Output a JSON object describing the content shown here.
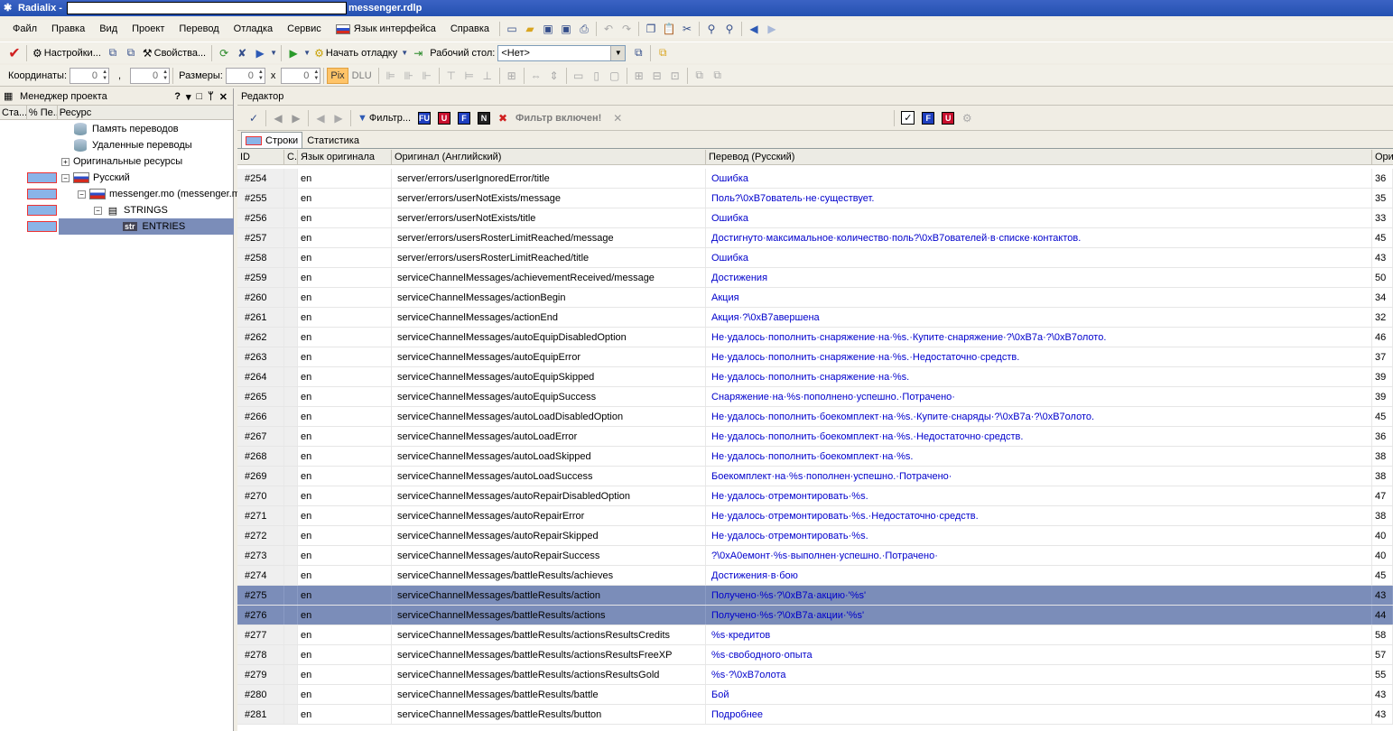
{
  "window": {
    "app_name": "Radialix",
    "title_separator": " - ",
    "file_name": "messenger.rdlp"
  },
  "menu": [
    "Файл",
    "Правка",
    "Вид",
    "Проект",
    "Перевод",
    "Отладка",
    "Сервис",
    "Язык интерфейса",
    "Справка"
  ],
  "toolbar1": {
    "settings_label": "Настройки...",
    "properties_label": "Свойства...",
    "start_debug_label": "Начать отладку",
    "workspace_label": "Рабочий стол:",
    "workspace_value": "<Нет>"
  },
  "toolbar2": {
    "coords_label": "Координаты:",
    "coord_x": "0",
    "comma": ",",
    "coord_y": "0",
    "sizes_label": "Размеры:",
    "size_w": "0",
    "x_sep": "x",
    "size_h": "0",
    "pix_label": "Pix",
    "dlu_label": "DLU"
  },
  "project_manager": {
    "title": "Менеджер проекта",
    "controls": [
      "?",
      "▾",
      "□",
      "ᛘ",
      "✕"
    ],
    "columns": [
      "Ста...",
      "% Пе...",
      "Ресурс"
    ],
    "tree": [
      {
        "label": "Память переводов"
      },
      {
        "label": "Удаленные переводы"
      },
      {
        "label": "Оригинальные ресурсы",
        "expander": "+"
      },
      {
        "label": "Русский",
        "expander": "−"
      },
      {
        "label": "messenger.mo (messenger.mo)",
        "expander": "−"
      },
      {
        "label": "STRINGS",
        "expander": "−"
      },
      {
        "label": "ENTRIES",
        "icon_text": "str"
      }
    ]
  },
  "editor": {
    "title": "Редактор",
    "filter_label": "Фильтр...",
    "filter_badges": [
      {
        "text": "FU",
        "color": "#1f3fbf"
      },
      {
        "text": "U",
        "color": "#c8102e"
      },
      {
        "text": "F",
        "color": "#1f3fbf"
      },
      {
        "text": "N",
        "color": "#222222"
      }
    ],
    "filter_status": "Фильтр включен!",
    "right_badges": [
      {
        "text": "F",
        "color": "#1f3fbf"
      },
      {
        "text": "U",
        "color": "#c8102e"
      }
    ],
    "tabs": [
      "Строки",
      "Статистика"
    ],
    "columns": [
      "ID",
      "С.",
      "Язык оригинала",
      "Оригинал (Английский)",
      "Перевод (Русский)",
      "Ори"
    ],
    "rows": [
      {
        "id": "#254",
        "lang": "en",
        "original": "server/errors/userIgnoredError/title",
        "translation": "Ошибка",
        "len": "36"
      },
      {
        "id": "#255",
        "lang": "en",
        "original": "server/errors/userNotExists/message",
        "translation": "Поль?\\0xB7ователь·не·существует.",
        "len": "35"
      },
      {
        "id": "#256",
        "lang": "en",
        "original": "server/errors/userNotExists/title",
        "translation": "Ошибка",
        "len": "33"
      },
      {
        "id": "#257",
        "lang": "en",
        "original": "server/errors/usersRosterLimitReached/message",
        "translation": "Достигнуто·максимальное·количество·поль?\\0xB7ователей·в·списке·контактов.",
        "len": "45"
      },
      {
        "id": "#258",
        "lang": "en",
        "original": "server/errors/usersRosterLimitReached/title",
        "translation": "Ошибка",
        "len": "43"
      },
      {
        "id": "#259",
        "lang": "en",
        "original": "serviceChannelMessages/achievementReceived/message",
        "translation": "Достижения",
        "len": "50"
      },
      {
        "id": "#260",
        "lang": "en",
        "original": "serviceChannelMessages/actionBegin",
        "translation": "Акция",
        "len": "34"
      },
      {
        "id": "#261",
        "lang": "en",
        "original": "serviceChannelMessages/actionEnd",
        "translation": "Акция·?\\0xB7авершена",
        "len": "32"
      },
      {
        "id": "#262",
        "lang": "en",
        "original": "serviceChannelMessages/autoEquipDisabledOption",
        "translation": "Не·удалось·пополнить·снаряжение·на·%s.·Купите·снаряжение·?\\0xB7а·?\\0xB7олото.",
        "len": "46"
      },
      {
        "id": "#263",
        "lang": "en",
        "original": "serviceChannelMessages/autoEquipError",
        "translation": "Не·удалось·пополнить·снаряжение·на·%s.·Недостаточно·средств.",
        "len": "37"
      },
      {
        "id": "#264",
        "lang": "en",
        "original": "serviceChannelMessages/autoEquipSkipped",
        "translation": "Не·удалось·пополнить·снаряжение·на·%s.",
        "len": "39"
      },
      {
        "id": "#265",
        "lang": "en",
        "original": "serviceChannelMessages/autoEquipSuccess",
        "translation": "Снаряжение·на·%s·пополнено·успешно.·Потрачено·",
        "len": "39"
      },
      {
        "id": "#266",
        "lang": "en",
        "original": "serviceChannelMessages/autoLoadDisabledOption",
        "translation": "Не·удалось·пополнить·боекомплект·на·%s.·Купите·снаряды·?\\0xB7а·?\\0xB7олото.",
        "len": "45"
      },
      {
        "id": "#267",
        "lang": "en",
        "original": "serviceChannelMessages/autoLoadError",
        "translation": "Не·удалось·пополнить·боекомплект·на·%s.·Недостаточно·средств.",
        "len": "36"
      },
      {
        "id": "#268",
        "lang": "en",
        "original": "serviceChannelMessages/autoLoadSkipped",
        "translation": "Не·удалось·пополнить·боекомплект·на·%s.",
        "len": "38"
      },
      {
        "id": "#269",
        "lang": "en",
        "original": "serviceChannelMessages/autoLoadSuccess",
        "translation": "Боекомплект·на·%s·пополнен·успешно.·Потрачено·",
        "len": "38"
      },
      {
        "id": "#270",
        "lang": "en",
        "original": "serviceChannelMessages/autoRepairDisabledOption",
        "translation": "Не·удалось·отремонтировать·%s.",
        "len": "47"
      },
      {
        "id": "#271",
        "lang": "en",
        "original": "serviceChannelMessages/autoRepairError",
        "translation": "Не·удалось·отремонтировать·%s.·Недостаточно·средств.",
        "len": "38"
      },
      {
        "id": "#272",
        "lang": "en",
        "original": "serviceChannelMessages/autoRepairSkipped",
        "translation": "Не·удалось·отремонтировать·%s.",
        "len": "40"
      },
      {
        "id": "#273",
        "lang": "en",
        "original": "serviceChannelMessages/autoRepairSuccess",
        "translation": "?\\0xA0емонт·%s·выполнен·успешно.·Потрачено·",
        "len": "40"
      },
      {
        "id": "#274",
        "lang": "en",
        "original": "serviceChannelMessages/battleResults/achieves",
        "translation": "Достижения·в·бою",
        "len": "45"
      },
      {
        "id": "#275",
        "lang": "en",
        "original": "serviceChannelMessages/battleResults/action",
        "translation": "Получено·%s·?\\0xB7а·акцию·'%s'",
        "len": "43",
        "selected": true
      },
      {
        "id": "#276",
        "lang": "en",
        "original": "serviceChannelMessages/battleResults/actions",
        "translation": "Получено·%s·?\\0xB7а·акции·'%s'",
        "len": "44",
        "selected": true
      },
      {
        "id": "#277",
        "lang": "en",
        "original": "serviceChannelMessages/battleResults/actionsResultsCredits",
        "translation": "%s·кредитов",
        "len": "58"
      },
      {
        "id": "#278",
        "lang": "en",
        "original": "serviceChannelMessages/battleResults/actionsResultsFreeXP",
        "translation": "%s·свободного·опыта",
        "len": "57"
      },
      {
        "id": "#279",
        "lang": "en",
        "original": "serviceChannelMessages/battleResults/actionsResultsGold",
        "translation": "%s·?\\0xB7олота",
        "len": "55"
      },
      {
        "id": "#280",
        "lang": "en",
        "original": "serviceChannelMessages/battleResults/battle",
        "translation": "Бой",
        "len": "43"
      },
      {
        "id": "#281",
        "lang": "en",
        "original": "serviceChannelMessages/battleResults/button",
        "translation": "Подробнее",
        "len": "43"
      }
    ]
  }
}
